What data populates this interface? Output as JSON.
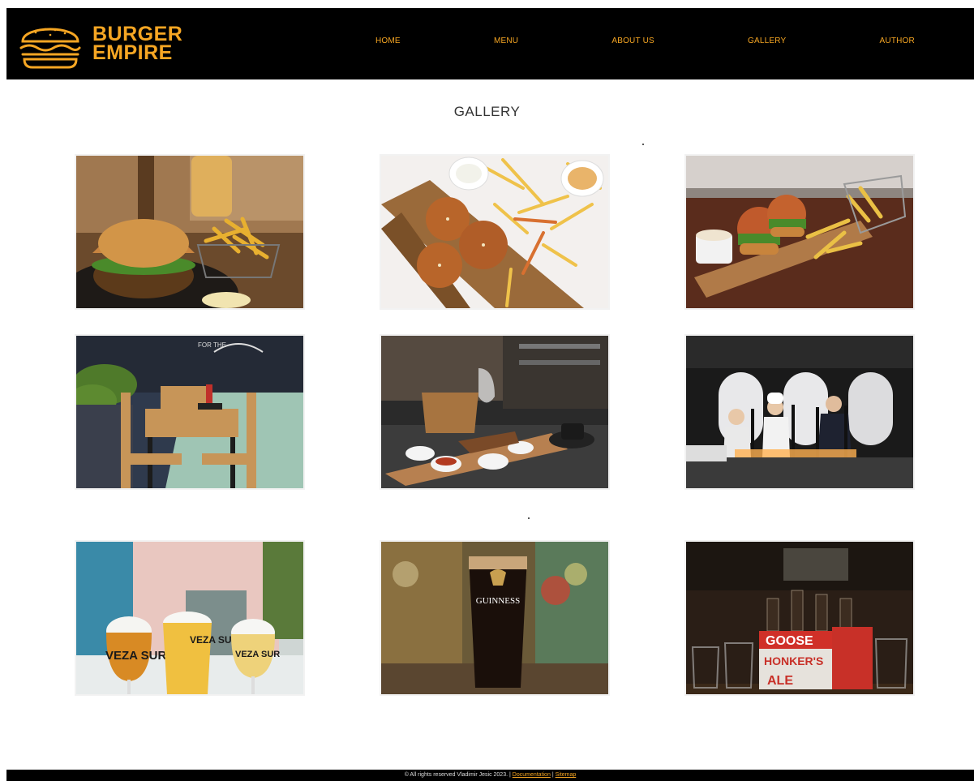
{
  "brand": {
    "line1": "BURGER",
    "line2": "EMPIRE"
  },
  "nav": {
    "home": "HOME",
    "menu": "MENU",
    "about": "ABOUT US",
    "gallery": "GALLERY",
    "author": "AUTHOR"
  },
  "page": {
    "title": "GALLERY"
  },
  "photos": {
    "p5": {
      "sign": "FOR THE"
    },
    "p7": {
      "glass1": "VEZA SUR",
      "glass2": "VEZA SUR",
      "glass3": "VEZA SUR"
    },
    "p8": {
      "glass": "GUINNESS"
    },
    "p9": {
      "box1": "GOOSE",
      "box2": "HONKER'S",
      "box3": "ALE"
    }
  },
  "footer": {
    "copyright": "© All rights reserved Vladimir Jesic 2023. |",
    "documentation": "Documentation",
    "separator": "|",
    "sitemap": "Sitemap"
  },
  "colors": {
    "accent": "#f6a623",
    "header_bg": "#000000"
  }
}
